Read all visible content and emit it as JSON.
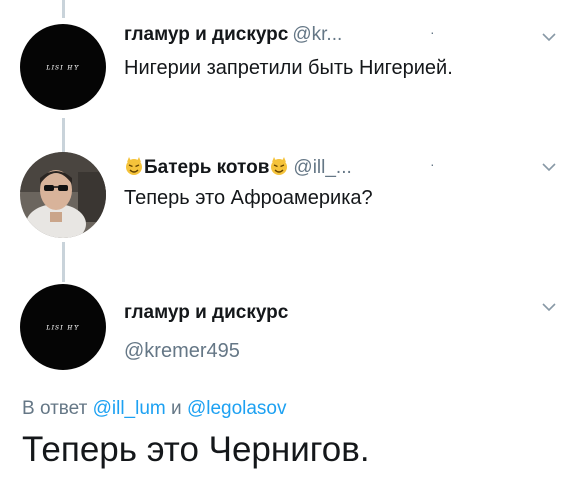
{
  "tweets": [
    {
      "name": "гламур и дискурс",
      "handle": "@kr...",
      "text": "Нигерии запретили быть Нигерией."
    },
    {
      "name": "Батерь котов",
      "handle": "@ill_...",
      "text": "Теперь это Афроамерика?"
    }
  ],
  "main_tweet": {
    "name": "гламур и дискурс",
    "handle": "@kremer495",
    "reply_prefix": "В ответ",
    "reply_user1": "@ill_lum",
    "reply_and": "и",
    "reply_user2": "@legolasov",
    "text": "Теперь это Чернигов."
  },
  "colors": {
    "text": "#14171a",
    "secondary": "#657786",
    "link": "#1da1f2",
    "thread_line": "#c9d3da"
  }
}
